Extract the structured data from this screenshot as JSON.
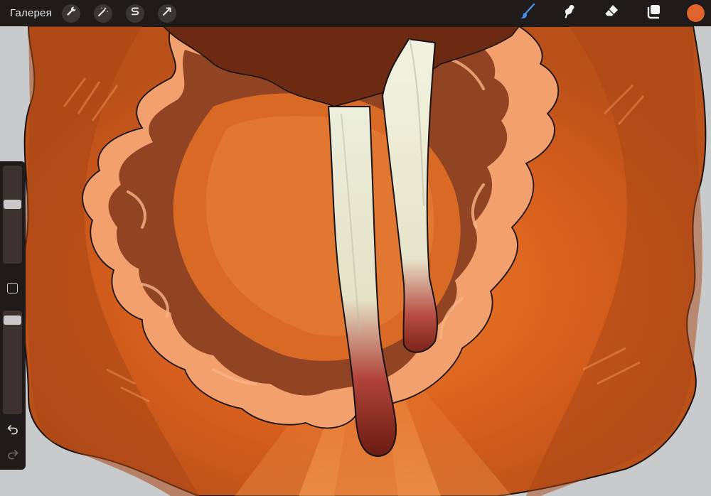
{
  "topbar": {
    "gallery_label": "Галерея",
    "left_tools": [
      {
        "name": "actions-wrench-icon"
      },
      {
        "name": "adjustments-magic-wand-icon"
      },
      {
        "name": "selection-s-icon"
      },
      {
        "name": "transform-arrow-icon"
      }
    ],
    "right_tools": [
      {
        "name": "brush-icon",
        "active": true
      },
      {
        "name": "smudge-icon"
      },
      {
        "name": "eraser-icon"
      },
      {
        "name": "layers-icon"
      }
    ],
    "current_color": "#e0632b"
  },
  "sidebar": {
    "brush_size_level": 0.62,
    "opacity_level": 0.95,
    "icons": [
      "modify-square-icon",
      "undo-icon",
      "redo-icon"
    ]
  },
  "colors": {
    "toolbar_bg": "#1f1b1a",
    "brush_active": "#4a90e2",
    "canvas_bg": "#c8cacb",
    "orange_main": "#d9641f",
    "orange_dark": "#8a3a14",
    "orange_light": "#f4a06a",
    "skin": "#e8ead2"
  }
}
